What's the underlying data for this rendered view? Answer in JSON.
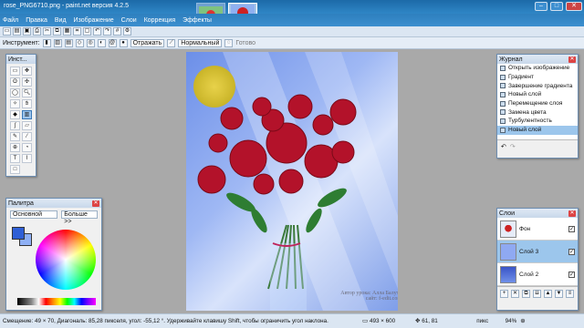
{
  "window": {
    "title": "rose_PNG6710.png - paint.net версия 4.2.5"
  },
  "menu": [
    "Файл",
    "Правка",
    "Вид",
    "Изображение",
    "Слои",
    "Коррекция",
    "Эффекты"
  ],
  "toolbar2": {
    "tool_label": "Инструмент:",
    "reflect_label": "Отражать",
    "blend_mode": "Нормальный",
    "done_label": "Готово"
  },
  "tools_panel": {
    "title": "Инст..."
  },
  "history_panel": {
    "title": "Журнал",
    "items": [
      "Открыть изображение",
      "Градиент",
      "Завершение градиента",
      "Новый слой",
      "Перемещение слоя",
      "Замена цвета",
      "Турбулентность",
      "Новый слой"
    ]
  },
  "palette_panel": {
    "title": "Палитра",
    "mode": "Основной",
    "more_button": "Больше >>"
  },
  "layers_panel": {
    "title": "Слои",
    "layers": [
      {
        "name": "Фон",
        "visible": true
      },
      {
        "name": "Слой 3",
        "visible": true
      },
      {
        "name": "Слой 2",
        "visible": true
      }
    ]
  },
  "canvas": {
    "watermark": "Автор урока: Алла Балута\nсайт: f-edit.com"
  },
  "status": {
    "hint": "Смещение: 49 × 70, Диагональ: 85,28 пикселя, угол: -55,12 °. Удерживайте клавишу Shift, чтобы ограничить угол наклона.",
    "size": "493 × 600",
    "coords": "61, 81",
    "units": "пикс",
    "zoom": "94%"
  },
  "colors": {
    "primary": "#2f5fd6",
    "secondary": "#8fb0f5",
    "accent": "#3b8fcf"
  }
}
